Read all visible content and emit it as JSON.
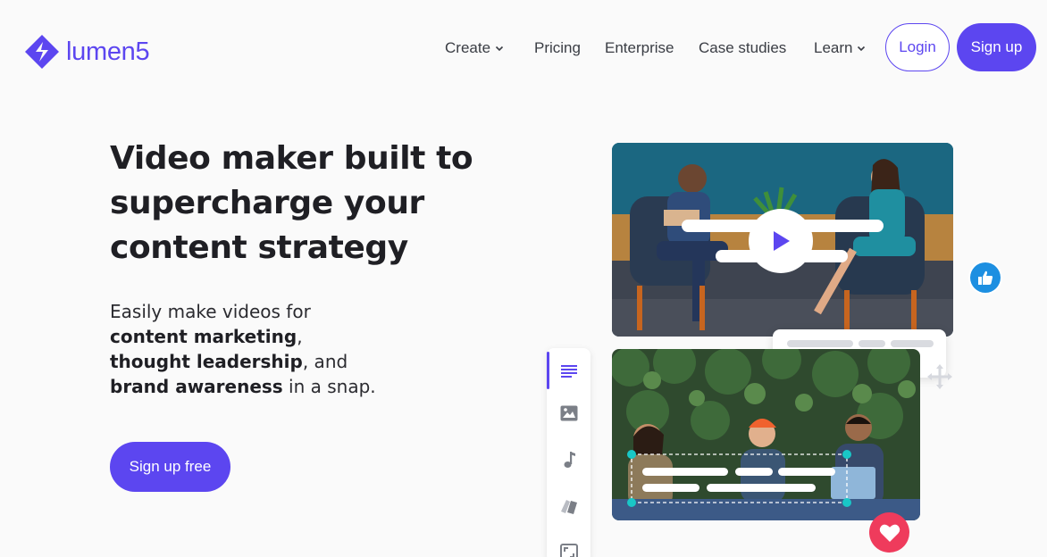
{
  "brand": {
    "name": "lumen5",
    "color": "#5c46f0"
  },
  "nav": {
    "items": [
      {
        "label": "Create",
        "has_dropdown": true
      },
      {
        "label": "Pricing",
        "has_dropdown": false
      },
      {
        "label": "Enterprise",
        "has_dropdown": false
      },
      {
        "label": "Case studies",
        "has_dropdown": false
      },
      {
        "label": "Learn",
        "has_dropdown": true
      }
    ],
    "login_label": "Login",
    "signup_label": "Sign up"
  },
  "hero": {
    "headline_lines": [
      "Video maker built to",
      "supercharge your",
      "content strategy"
    ],
    "sub_intro": "Easily make videos for",
    "sub_item_1": "content marketing",
    "sub_after_1": ",",
    "sub_item_2": "thought leadership",
    "sub_after_2": ", and",
    "sub_item_3": "brand awareness",
    "sub_after_3": " in a snap.",
    "cta_label": "Sign up free"
  },
  "illustration": {
    "editor_tools": [
      "text-icon",
      "image-icon",
      "music-icon",
      "style-icon",
      "resize-icon"
    ],
    "badges": [
      "thumbs-up-icon",
      "heart-icon"
    ],
    "colors": {
      "accent": "#5c46f0",
      "like": "#1d8fe1",
      "heart": "#ef3b5c",
      "handle": "#19c7c7"
    }
  }
}
